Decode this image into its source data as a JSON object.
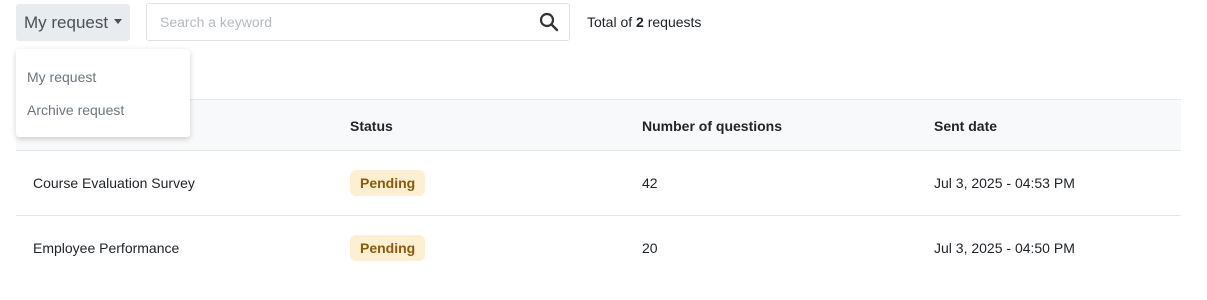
{
  "filter": {
    "selected": "My request",
    "options": [
      "My request",
      "Archive request"
    ]
  },
  "search": {
    "placeholder": "Search a keyword",
    "value": ""
  },
  "summary": {
    "prefix": "Total of",
    "count": "2",
    "suffix": "requests"
  },
  "table": {
    "headers": [
      "Status",
      "Number of questions",
      "Sent date"
    ],
    "rows": [
      {
        "name": "Course Evaluation Survey",
        "status": "Pending",
        "questions": "42",
        "sent": "Jul 3, 2025 - 04:53 PM"
      },
      {
        "name": "Employee Performance",
        "status": "Pending",
        "questions": "20",
        "sent": "Jul 3, 2025 - 04:50 PM"
      }
    ]
  },
  "colors": {
    "badge_bg": "#fdefd2",
    "badge_text": "#8a5a0a",
    "toggle_bg": "#e9ecef"
  }
}
